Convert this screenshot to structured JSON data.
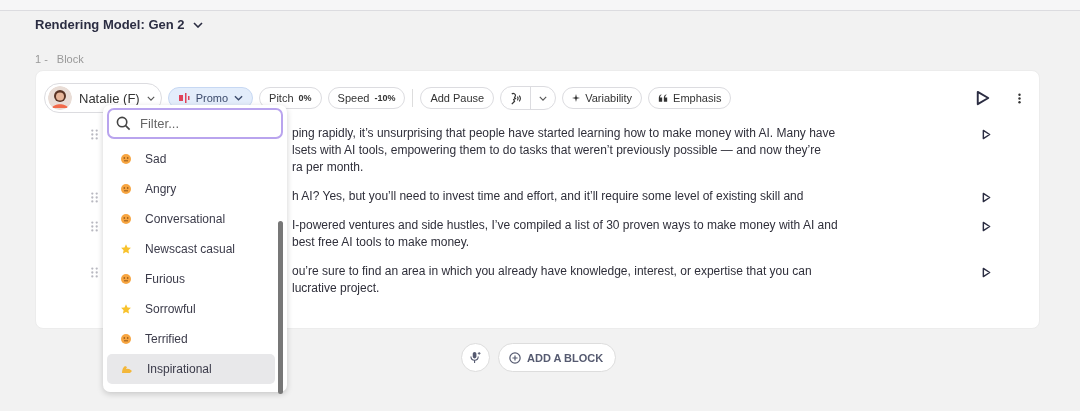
{
  "model_selector": {
    "label": "Rendering Model: Gen 2"
  },
  "block": {
    "index": "1 -",
    "title": "Block"
  },
  "toolbar": {
    "voice": "Natalie (F)",
    "style": {
      "label": "Promo",
      "selected": true
    },
    "pitch": {
      "label": "Pitch",
      "value": "0%"
    },
    "speed": {
      "label": "Speed",
      "value": "-10%"
    },
    "add_pause": "Add Pause",
    "variability": "Variability",
    "emphasis": "Emphasis"
  },
  "paragraphs": [
    {
      "lines": [
        "ping rapidly, it’s unsurprising that people have started learning how to make money with AI. Many have",
        "lsets with AI tools, empowering them to do tasks that weren’t previously possible — and now they’re",
        "ra per month."
      ]
    },
    {
      "lines": [
        "h AI? Yes, but you’ll need to invest time and effort, and it’ll require some level of existing skill and"
      ]
    },
    {
      "lines": [
        "I-powered ventures and side hustles, I’ve compiled a list of 30 proven ways to make money with AI and",
        "best free AI tools to make money."
      ]
    },
    {
      "lines": [
        "ou’re sure to find an area in which you already have knowledge, interest, or expertise that you can",
        "lucrative project."
      ]
    }
  ],
  "dropdown": {
    "placeholder": "Filter...",
    "items": [
      {
        "label": "Sad",
        "kind": "face",
        "selected": false
      },
      {
        "label": "Angry",
        "kind": "face",
        "selected": false
      },
      {
        "label": "Conversational",
        "kind": "face",
        "selected": false
      },
      {
        "label": "Newscast casual",
        "kind": "star",
        "selected": false
      },
      {
        "label": "Furious",
        "kind": "face",
        "selected": false
      },
      {
        "label": "Sorrowful",
        "kind": "star",
        "selected": false
      },
      {
        "label": "Terrified",
        "kind": "face",
        "selected": false
      },
      {
        "label": "Inspirational",
        "kind": "arm",
        "selected": true
      }
    ]
  },
  "add_block": "ADD A BLOCK"
}
